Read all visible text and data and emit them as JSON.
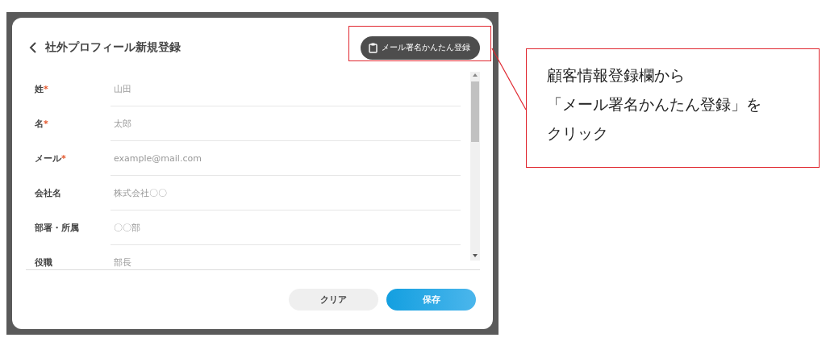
{
  "dialog": {
    "title": "社外プロフィール新規登録",
    "signature_button": "メール署名かんたん登録",
    "fields": [
      {
        "label": "姓",
        "required": true,
        "placeholder": "山田"
      },
      {
        "label": "名",
        "required": true,
        "placeholder": "太郎"
      },
      {
        "label": "メール",
        "required": true,
        "placeholder": "example@mail.com"
      },
      {
        "label": "会社名",
        "required": false,
        "placeholder": "株式会社〇〇"
      },
      {
        "label": "部署・所属",
        "required": false,
        "placeholder": "〇〇部"
      },
      {
        "label": "役職",
        "required": false,
        "placeholder": "部長"
      }
    ],
    "buttons": [
      {
        "label": "クリア",
        "kind": "secondary"
      },
      {
        "label": "保存",
        "kind": "primary"
      }
    ],
    "required_mark": "*"
  },
  "callout": {
    "lines": [
      "顧客情報登録欄から",
      "「メール署名かんたん登録」を",
      "クリック"
    ]
  }
}
